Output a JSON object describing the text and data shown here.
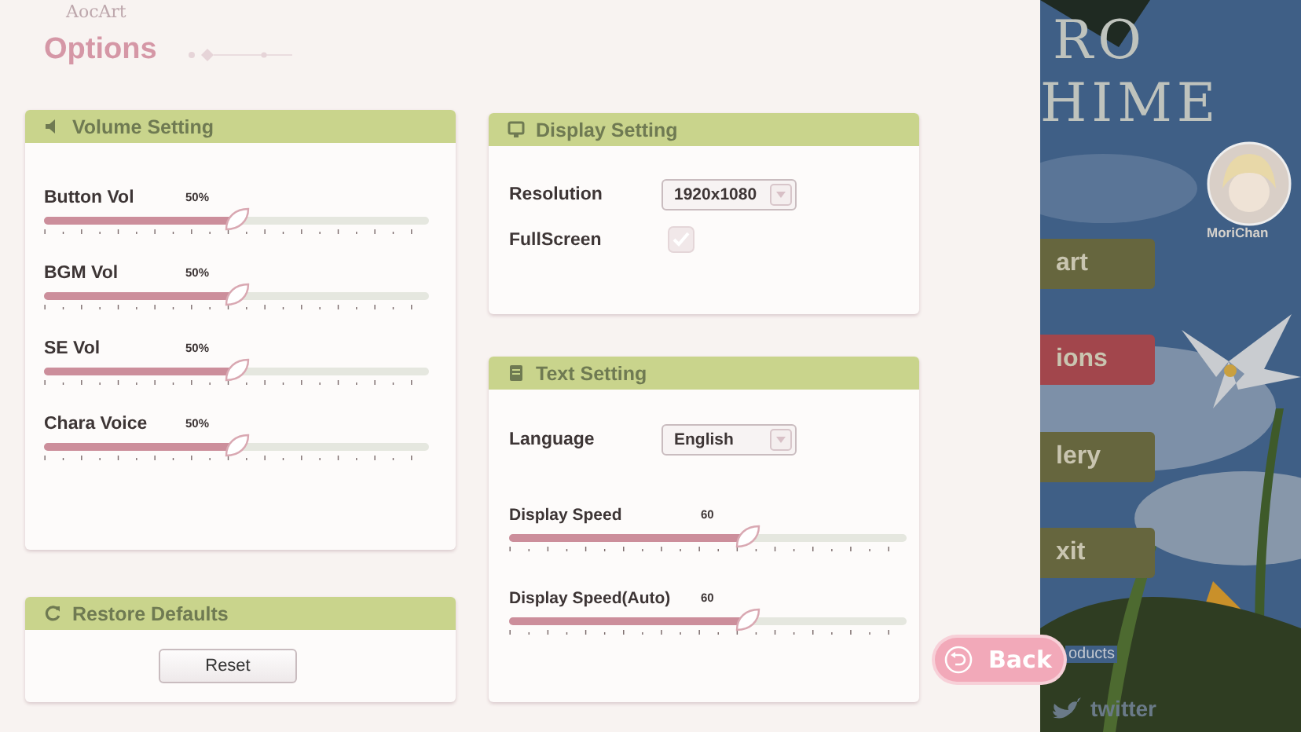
{
  "header": {
    "brand": "AocArt",
    "title": "Options"
  },
  "volume": {
    "title": "Volume Setting",
    "sliders": [
      {
        "label": "Button Vol",
        "reading": "50%",
        "level": 0.5
      },
      {
        "label": "BGM Vol",
        "reading": "50%",
        "level": 0.5
      },
      {
        "label": "SE Vol",
        "reading": "50%",
        "level": 0.5
      },
      {
        "label": "Chara Voice",
        "reading": "50%",
        "level": 0.5
      }
    ]
  },
  "restore": {
    "title": "Restore Defaults",
    "button": "Reset"
  },
  "display": {
    "title": "Display Setting",
    "resolution": {
      "label": "Resolution",
      "value": "1920x1080"
    },
    "fullscreen": {
      "label": "FullScreen",
      "checked": true
    }
  },
  "text": {
    "title": "Text Setting",
    "language": {
      "label": "Language",
      "value": "English"
    },
    "sliders": [
      {
        "label": "Display Speed",
        "reading": "60",
        "level": 0.6
      },
      {
        "label": "Display Speed(Auto)",
        "reading": "60",
        "level": 0.6
      }
    ]
  },
  "back_button": "Back",
  "background": {
    "logo": [
      "RO",
      "HIME"
    ],
    "avatar_name": "MoriChan",
    "menu": [
      {
        "label": "art",
        "selected": false
      },
      {
        "label": "ions",
        "selected": true
      },
      {
        "label": "lery",
        "selected": false
      },
      {
        "label": "xit",
        "selected": false
      }
    ],
    "links": [
      "oducts",
      "twitter"
    ]
  }
}
